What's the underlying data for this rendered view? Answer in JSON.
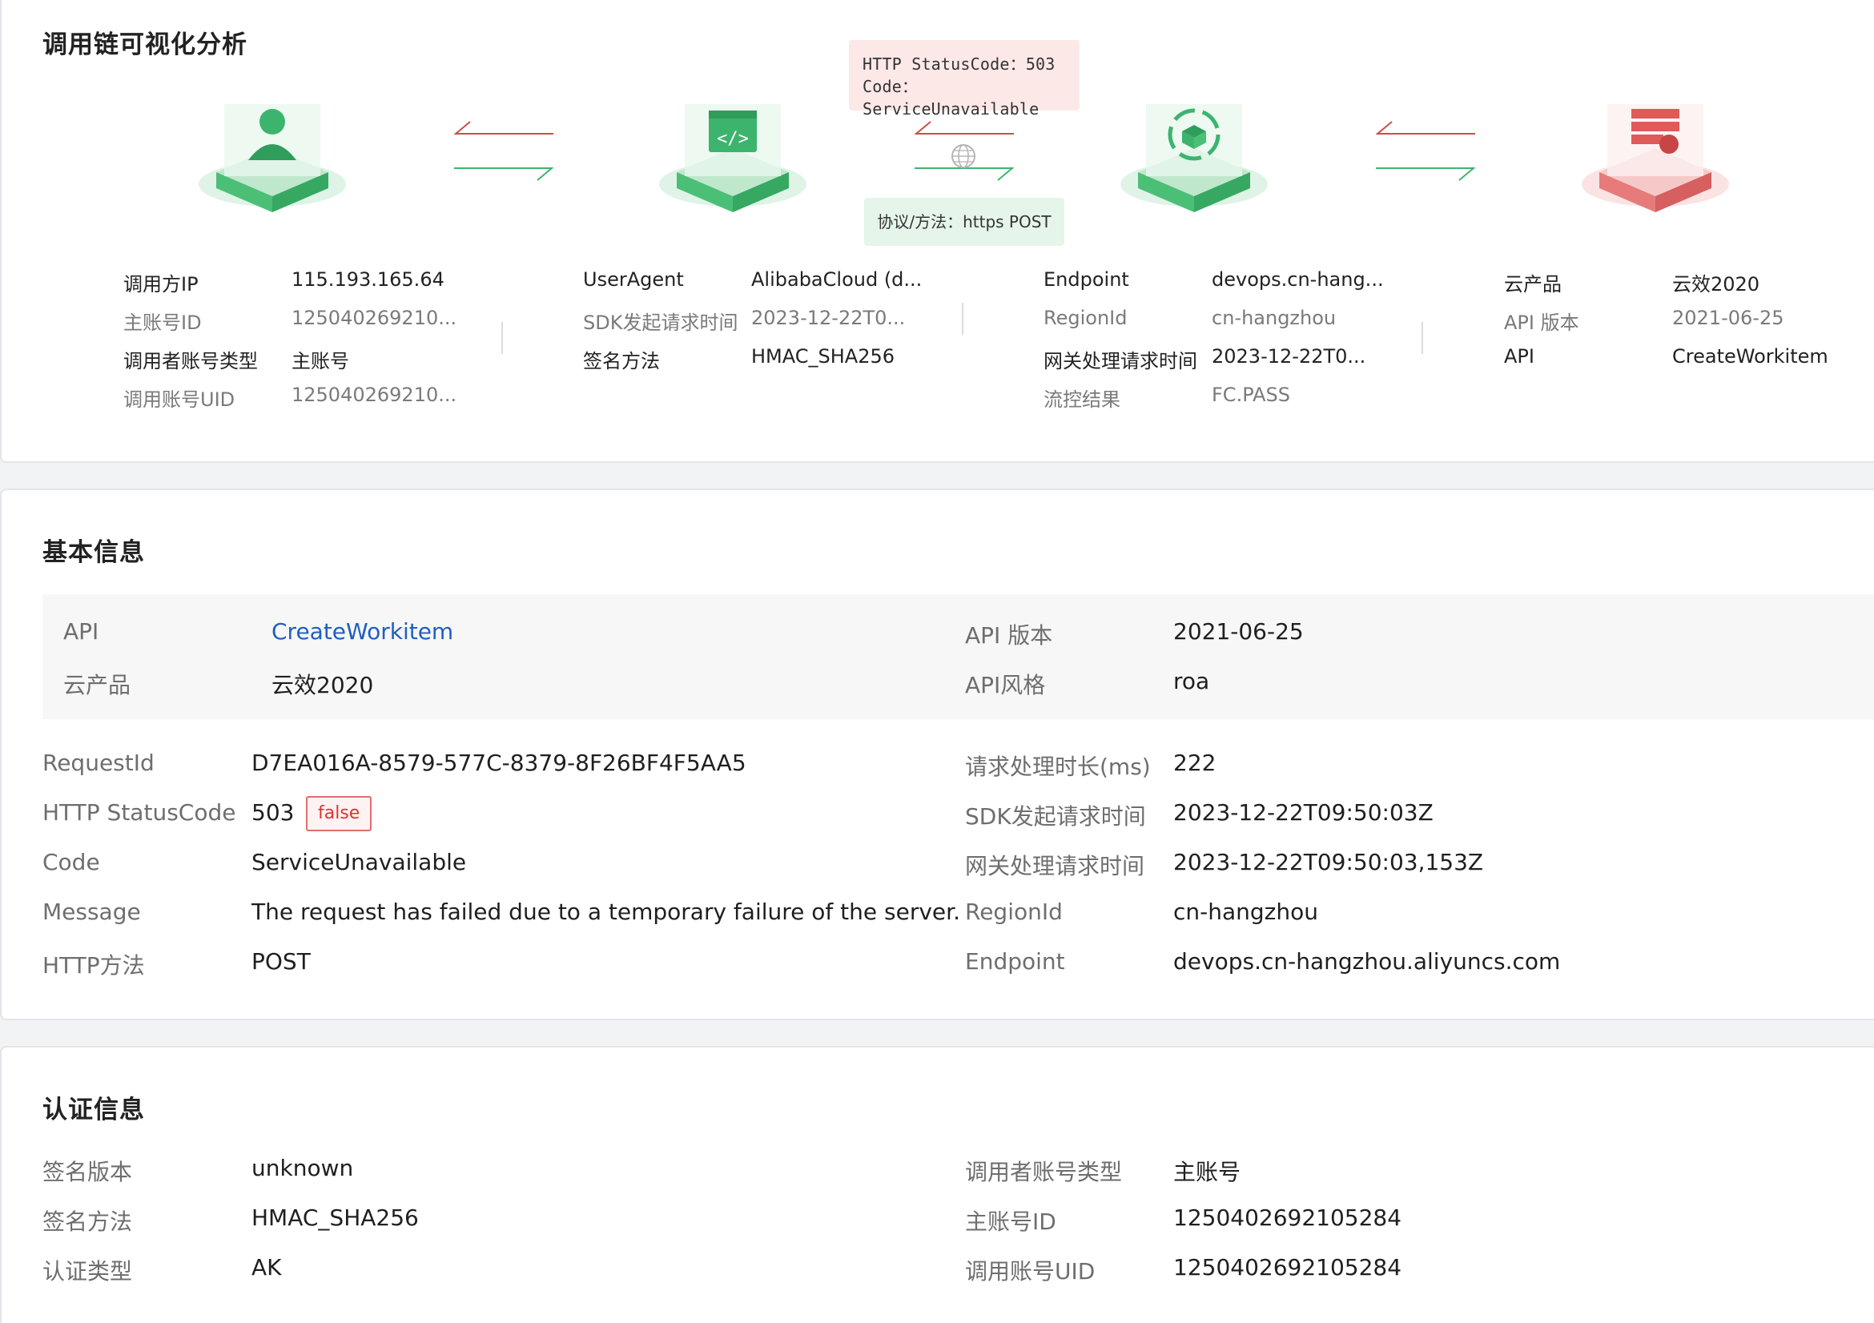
{
  "chain": {
    "title": "调用链可视化分析",
    "tooltip_response": {
      "line1": "HTTP StatusCode：503",
      "line2": "Code：ServiceUnavailable"
    },
    "tooltip_protocol": "协议/方法：https POST",
    "nodes": [
      {
        "icon": "user-icon",
        "color": "#3cb46e",
        "rows": [
          {
            "label": "调用方IP",
            "value": "115.193.165.64",
            "muted": false
          },
          {
            "label": "主账号ID",
            "value": "125040269210...",
            "muted": true
          },
          {
            "label": "调用者账号类型",
            "value": "主账号",
            "muted": false
          },
          {
            "label": "调用账号UID",
            "value": "125040269210...",
            "muted": true
          }
        ]
      },
      {
        "icon": "code-window-icon",
        "color": "#3cb46e",
        "rows": [
          {
            "label": "UserAgent",
            "value": "AlibabaCloud (d...",
            "muted": false
          },
          {
            "label": "SDK发起请求时间",
            "value": "2023-12-22T0...",
            "muted": true
          },
          {
            "label": "签名方法",
            "value": "HMAC_SHA256",
            "muted": false
          }
        ]
      },
      {
        "icon": "gateway-cube-icon",
        "color": "#3cb46e",
        "rows": [
          {
            "label": "Endpoint",
            "value": "devops.cn-hang...",
            "muted": false
          },
          {
            "label": "RegionId",
            "value": "cn-hangzhou",
            "muted": true
          },
          {
            "label": "网关处理请求时间",
            "value": "2023-12-22T0...",
            "muted": false
          },
          {
            "label": "流控结果",
            "value": "FC.PASS",
            "muted": true
          }
        ]
      },
      {
        "icon": "cloud-product-icon",
        "color": "#e05a5a",
        "rows": [
          {
            "label": "云产品",
            "value": "云效2020",
            "muted": false
          },
          {
            "label": "API 版本",
            "value": "2021-06-25",
            "muted": true
          },
          {
            "label": "API",
            "value": "CreateWorkitem",
            "muted": false
          }
        ]
      }
    ]
  },
  "basic": {
    "title": "基本信息",
    "shaded": {
      "api_label": "API",
      "api_value": "CreateWorkitem",
      "product_label": "云产品",
      "product_value": "云效2020",
      "version_label": "API 版本",
      "version_value": "2021-06-25",
      "style_label": "API风格",
      "style_value": "roa"
    },
    "left": [
      {
        "label": "RequestId",
        "value": "D7EA016A-8579-577C-8379-8F26BF4F5AA5"
      },
      {
        "label": "HTTP StatusCode",
        "value": "503"
      },
      {
        "label": "Code",
        "value": "ServiceUnavailable"
      },
      {
        "label": "Message",
        "value": "The request has failed due to a temporary failure of the server."
      },
      {
        "label": "HTTP方法",
        "value": "POST"
      }
    ],
    "status_tag": "false",
    "right": [
      {
        "label": "请求处理时长(ms)",
        "value": "222"
      },
      {
        "label": "SDK发起请求时间",
        "value": "2023-12-22T09:50:03Z"
      },
      {
        "label": "网关处理请求时间",
        "value": "2023-12-22T09:50:03,153Z"
      },
      {
        "label": "RegionId",
        "value": "cn-hangzhou"
      },
      {
        "label": "Endpoint",
        "value": "devops.cn-hangzhou.aliyuncs.com"
      }
    ]
  },
  "auth": {
    "title": "认证信息",
    "left": [
      {
        "label": "签名版本",
        "value": "unknown"
      },
      {
        "label": "签名方法",
        "value": "HMAC_SHA256"
      },
      {
        "label": "认证类型",
        "value": "AK"
      }
    ],
    "right": [
      {
        "label": "调用者账号类型",
        "value": "主账号"
      },
      {
        "label": "主账号ID",
        "value": "1250402692105284"
      },
      {
        "label": "调用账号UID",
        "value": "1250402692105284"
      }
    ]
  }
}
